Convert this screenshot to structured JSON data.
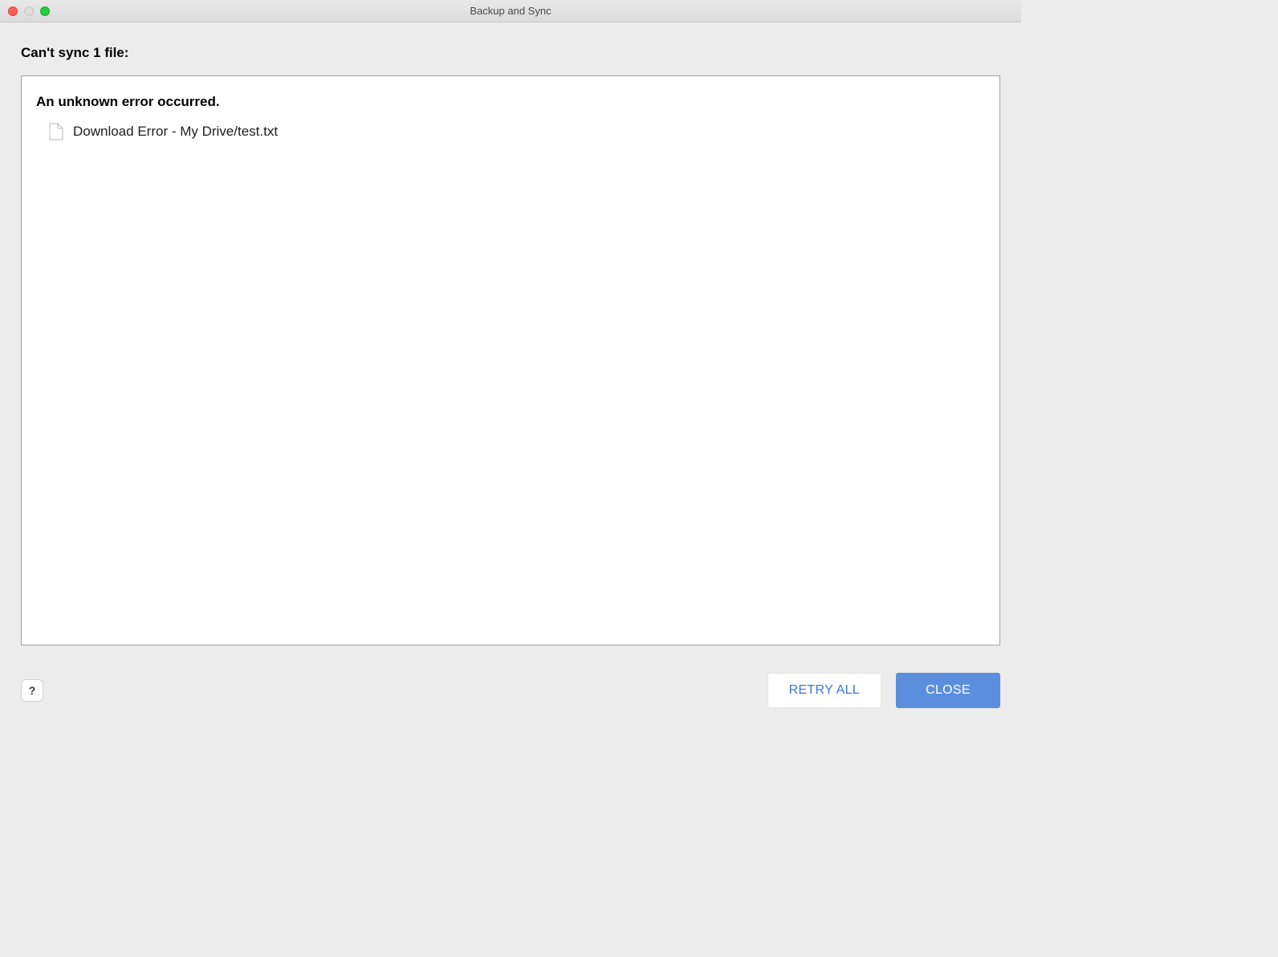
{
  "window": {
    "title": "Backup and Sync"
  },
  "heading": "Can't sync 1 file:",
  "error": {
    "title": "An unknown error occurred.",
    "files": [
      {
        "label": "Download Error - My Drive/test.txt"
      }
    ]
  },
  "footer": {
    "help_label": "?",
    "retry_label": "RETRY ALL",
    "close_label": "CLOSE"
  }
}
